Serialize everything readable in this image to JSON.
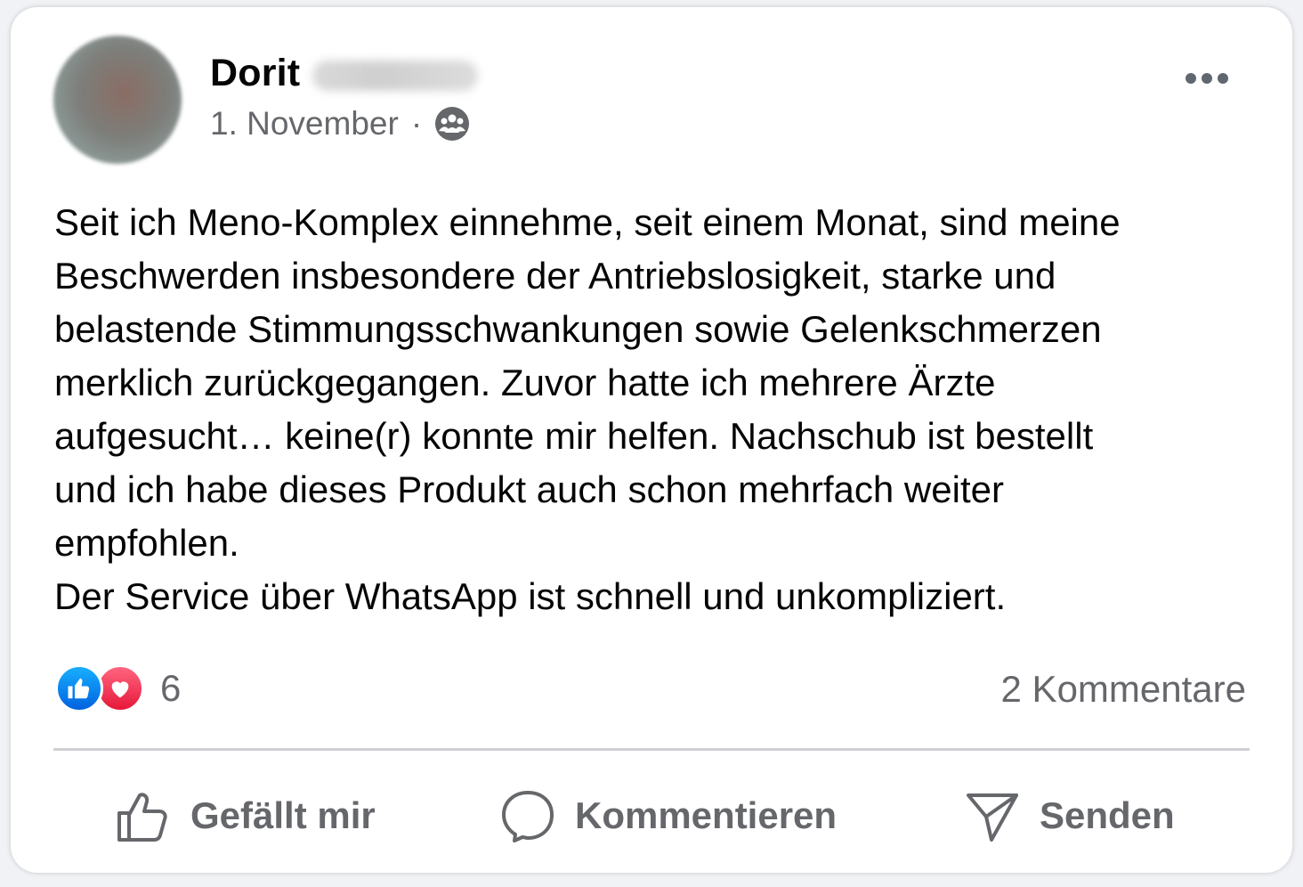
{
  "post": {
    "author_first_name": "Dorit",
    "date": "1. November",
    "separator": "·",
    "privacy_icon": "group-icon",
    "more_icon": "more-options-icon",
    "text_lines": [
      "Seit ich Meno-Komplex einnehme, seit einem Monat, sind meine",
      "Beschwerden insbesondere der Antriebslosigkeit, starke und",
      "belastende Stimmungsschwankungen sowie Gelenkschmerzen",
      "merklich zurückgegangen. Zuvor hatte ich mehrere Ärzte",
      "aufgesucht… keine(r) konnte mir helfen. Nachschub ist bestellt",
      "und ich habe dieses Produkt auch schon mehrfach weiter",
      "empfohlen.",
      "Der Service über WhatsApp ist schnell und unkompliziert."
    ]
  },
  "reactions": {
    "icons": [
      "like-reaction-icon",
      "love-reaction-icon"
    ],
    "count": "6",
    "comments": "2 Kommentare"
  },
  "actions": {
    "like_label": "Gefällt mir",
    "comment_label": "Kommentieren",
    "send_label": "Senden"
  },
  "colors": {
    "text_primary": "#050505",
    "text_secondary": "#65676b",
    "like_blue": "#0866ff",
    "love_red": "#f33e58",
    "divider": "#ced0d4"
  }
}
